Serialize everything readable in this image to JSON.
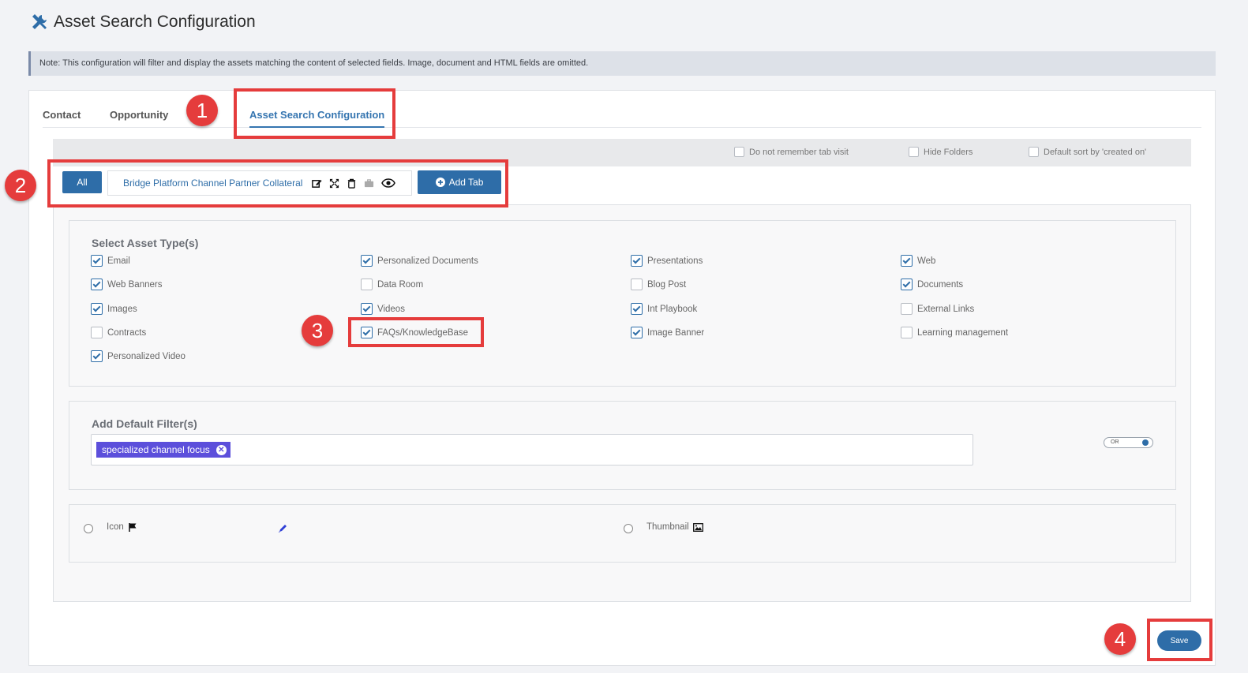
{
  "header": {
    "title": "Asset Search Configuration",
    "icon": "tools-icon"
  },
  "note": "Note: This configuration will filter and display the assets matching the content of selected fields. Image, document and HTML fields are omitted.",
  "tabs": [
    {
      "label": "Contact",
      "active": false
    },
    {
      "label": "Opportunity",
      "active": false
    },
    {
      "label": "Asset Search Configuration",
      "active": true
    }
  ],
  "options": [
    {
      "label": "Do not remember tab visit",
      "checked": false
    },
    {
      "label": "Hide Folders",
      "checked": false
    },
    {
      "label": "Default sort by 'created on'",
      "checked": false
    }
  ],
  "subtabs": {
    "all_label": "All",
    "current_label": "Bridge Platform Channel Partner Collateral",
    "icons": [
      "edit-icon",
      "expand-icon",
      "trash-icon",
      "briefcase-icon",
      "eye-icon"
    ],
    "add_label": "Add Tab"
  },
  "asset_types": {
    "title": "Select Asset Type(s)",
    "columns": [
      [
        {
          "label": "Email",
          "checked": true
        },
        {
          "label": "Web Banners",
          "checked": true
        },
        {
          "label": "Images",
          "checked": true
        },
        {
          "label": "Contracts",
          "checked": false
        },
        {
          "label": "Personalized Video",
          "checked": true
        }
      ],
      [
        {
          "label": "Personalized Documents",
          "checked": true
        },
        {
          "label": "Data Room",
          "checked": false
        },
        {
          "label": "Videos",
          "checked": true
        },
        {
          "label": "FAQs/KnowledgeBase",
          "checked": true
        }
      ],
      [
        {
          "label": "Presentations",
          "checked": true
        },
        {
          "label": "Blog Post",
          "checked": false
        },
        {
          "label": "Int Playbook",
          "checked": true
        },
        {
          "label": "Image Banner",
          "checked": true
        }
      ],
      [
        {
          "label": "Web",
          "checked": true
        },
        {
          "label": "Documents",
          "checked": true
        },
        {
          "label": "External Links",
          "checked": false
        },
        {
          "label": "Learning management",
          "checked": false
        }
      ]
    ]
  },
  "filters": {
    "title": "Add Default Filter(s)",
    "chips": [
      "specialized channel focus"
    ],
    "toggle_label": "OR"
  },
  "display": {
    "icon_label": "Icon",
    "thumbnail_label": "Thumbnail"
  },
  "save_label": "Save",
  "markers": [
    "1",
    "2",
    "3",
    "4"
  ],
  "colors": {
    "primary": "#2e6da8",
    "chip": "#5c4fdb",
    "annotation": "#e53c3c"
  }
}
